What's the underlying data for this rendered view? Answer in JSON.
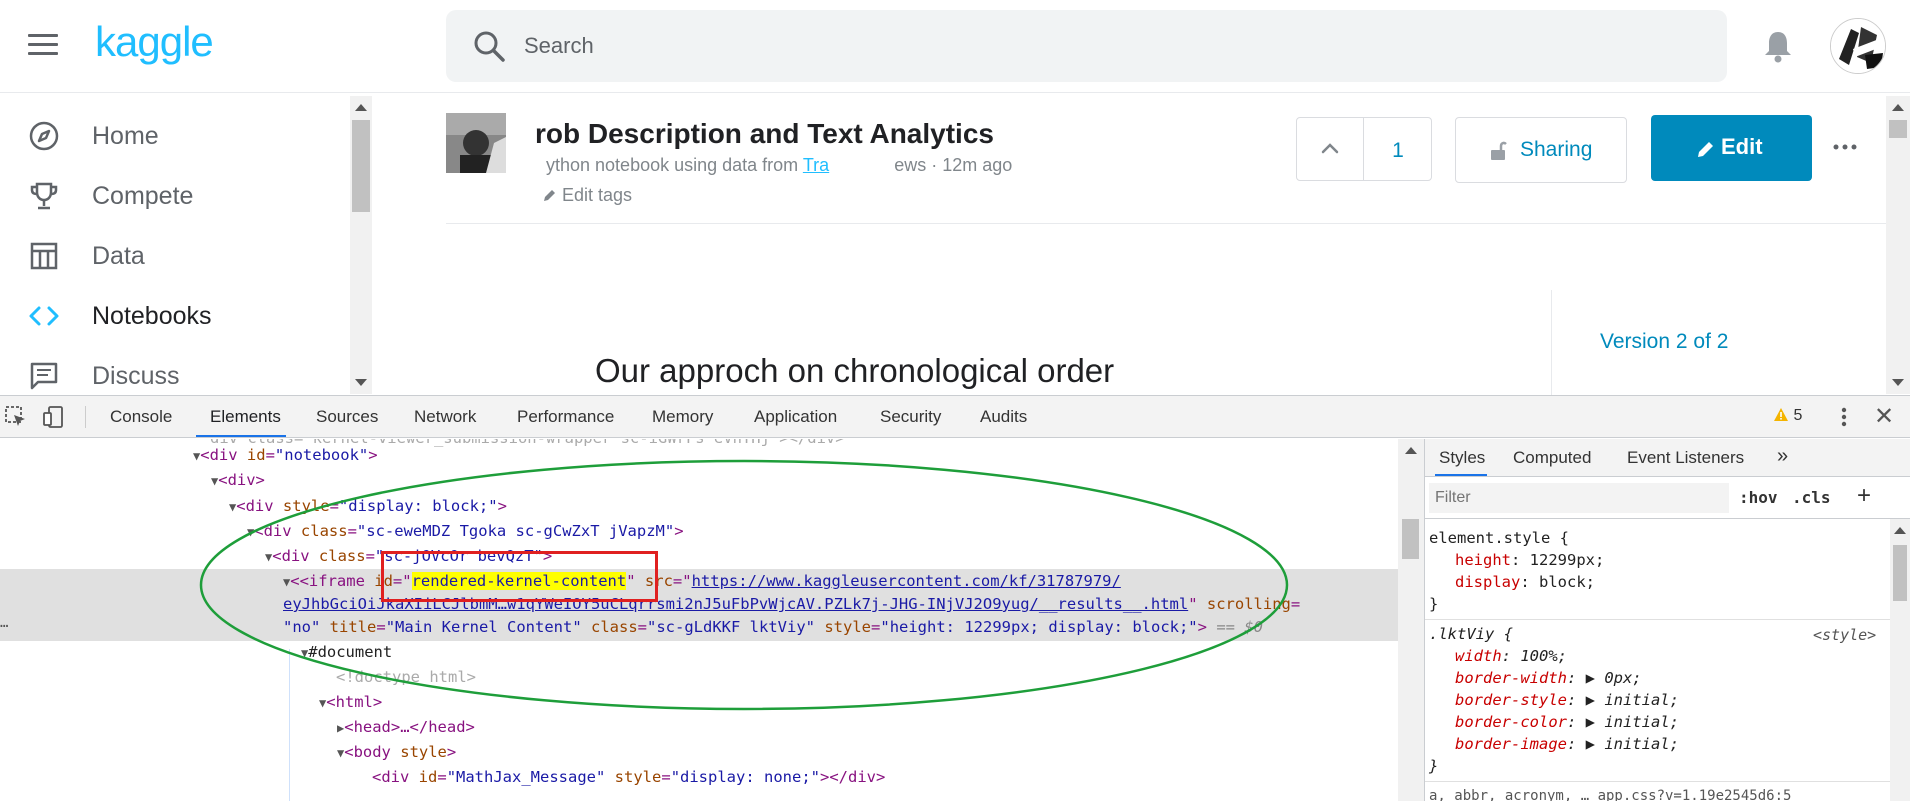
{
  "header": {
    "logo": "kaggle",
    "search_placeholder": "Search"
  },
  "nav": {
    "items": [
      {
        "label": "Home",
        "icon": "compass-icon"
      },
      {
        "label": "Compete",
        "icon": "trophy-icon"
      },
      {
        "label": "Data",
        "icon": "table-icon"
      },
      {
        "label": "Notebooks",
        "icon": "code-icon",
        "active": true
      },
      {
        "label": "Discuss",
        "icon": "chat-icon"
      }
    ]
  },
  "notebook": {
    "title": "rob Description and Text Analytics",
    "subtitle_prefix": "ython notebook using data from",
    "subtitle_link": "Tra",
    "subtitle_suffix": "ews · 12m ago",
    "edit_tags": "Edit tags",
    "vote_count": "1",
    "sharing_label": "Sharing",
    "edit_label": "Edit",
    "more_label": "...",
    "version_label": "Version 2 of 2",
    "content_heading": "Our approch on chronological order"
  },
  "devtools": {
    "tabs": [
      "Console",
      "Elements",
      "Sources",
      "Network",
      "Performance",
      "Memory",
      "Application",
      "Security",
      "Audits"
    ],
    "active_tab": "Elements",
    "warning_count": "5",
    "close_label": "✕",
    "dom": {
      "top_partial": "div class=\"kernel-viewer_submission-wrapper sc-iGWrFs eVnTHj\"></div>",
      "line_notebook_tag": "<div ",
      "line_notebook_attr": "id",
      "line_notebook_val": "\"notebook\"",
      "line_div": "<div>",
      "line_style_attr": "style",
      "line_style_val": "\"display: block;\"",
      "line_class1_attr": "class",
      "line_class1_val": "\"sc-eweMDZ Tgoka sc-gCwZxT jVapzM\"",
      "line_class2_val": "\"sc-jOVcOr bevQzT\"",
      "iframe_tag": "<iframe ",
      "iframe_id_attr": "id",
      "iframe_id_val": "rendered-kernel-content",
      "iframe_src_attr": "src",
      "iframe_src_url1": "https://www.kaggleusercontent.com/kf/31787979/",
      "iframe_src_url2": "eyJhbGciOiJkaXIiLCJlbmM…w1qYWeIOY5uCLqrrsmi2nJ5uFbPvWjcAV.PZLk7j-JHG-INjVJ2O9yug/__results__.html",
      "iframe_scrolling_attr": "scrolling",
      "iframe_scrolling_val": "\"no\"",
      "iframe_title_attr": "title",
      "iframe_title_val": "\"Main Kernel Content\"",
      "iframe_class_attr": "class",
      "iframe_class_val": "\"sc-gLdKKF lktViy\"",
      "iframe_style_attr": "style",
      "iframe_style_val": "\"height: 12299px; display: block;\"",
      "iframe_eq": "== $0",
      "document": "#document",
      "doctype": "<!doctype html>",
      "html": "<html>",
      "head": "<head>…</head>",
      "body_tag": "<body ",
      "body_attr": "style",
      "mathjax_tag_open": "<div ",
      "mathjax_id_attr": "id",
      "mathjax_id_val": "\"MathJax_Message\"",
      "mathjax_style_attr": "style",
      "mathjax_style_val": "\"display: none;\"",
      "mathjax_close": "></div>"
    },
    "styles": {
      "tabs": [
        "Styles",
        "Computed",
        "Event Listeners"
      ],
      "filter_placeholder": "Filter",
      "hov": ":hov",
      "cls": ".cls",
      "plus": "+",
      "rule1_selector": "element.style {",
      "rule1_props": [
        {
          "name": "height",
          "value": "12299px;"
        },
        {
          "name": "display",
          "value": "block;"
        }
      ],
      "rule2_selector": ".lktViy {",
      "rule2_source": "<style>",
      "rule2_props": [
        {
          "name": "width",
          "value": "100%;"
        },
        {
          "name": "border-width",
          "value": "0px;"
        },
        {
          "name": "border-style",
          "value": "initial;"
        },
        {
          "name": "border-color",
          "value": "initial;"
        },
        {
          "name": "border-image",
          "value": "initial;"
        }
      ],
      "close_brace": "}",
      "bottom_partial": "a, abbr, acronym, … app.css?v=1.19e2545d6:5"
    }
  },
  "colors": {
    "kaggle_blue": "#20beff",
    "edit_button": "#008abc",
    "annotation_red": "#e02020",
    "annotation_green": "#1e9e3a",
    "highlight_yellow": "#ffff00"
  }
}
